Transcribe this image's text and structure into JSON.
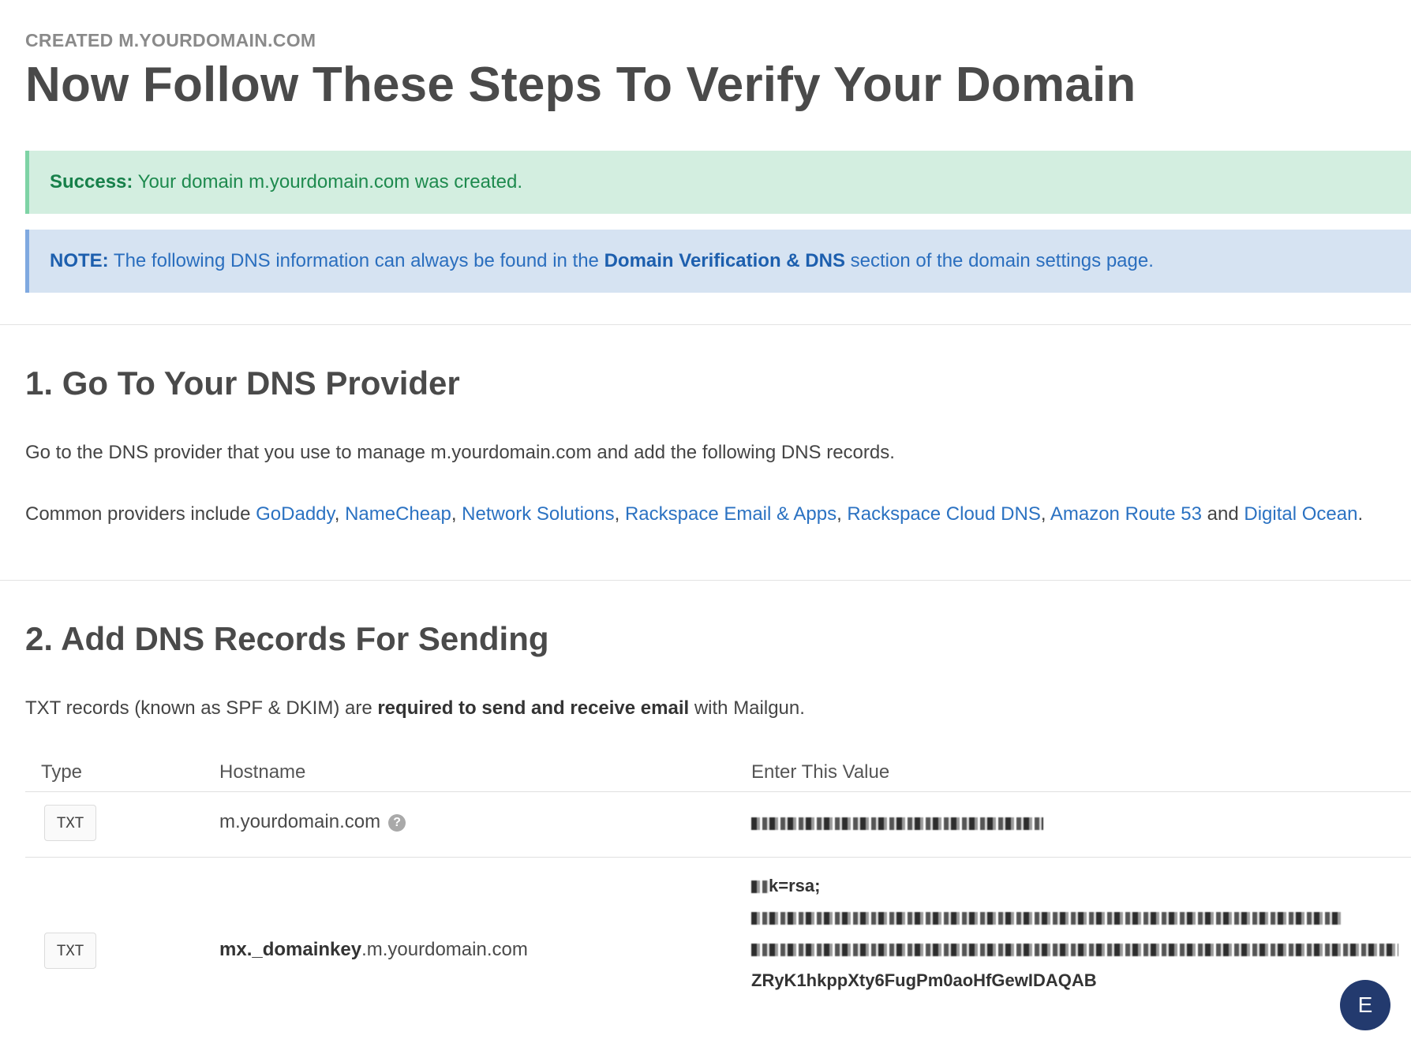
{
  "header": {
    "overline": "CREATED M.YOURDOMAIN.COM",
    "title": "Now Follow These Steps To Verify Your Domain"
  },
  "alerts": {
    "success_label": "Success:",
    "success_text": " Your domain m.yourdomain.com was created.",
    "note_label": "NOTE:",
    "note_text_1": " The following DNS information can always be found in the ",
    "note_link": "Domain Verification & DNS",
    "note_text_2": " section of the domain settings page."
  },
  "step1": {
    "title": "1. Go To Your DNS Provider",
    "intro": "Go to the DNS provider that you use to manage m.yourdomain.com and add the following DNS records.",
    "providers_prefix": "Common providers include ",
    "providers": [
      "GoDaddy",
      "NameCheap",
      "Network Solutions",
      "Rackspace Email & Apps",
      "Rackspace Cloud DNS",
      "Amazon Route 53"
    ],
    "providers_and": " and ",
    "providers_last": "Digital Ocean",
    "providers_suffix": "."
  },
  "step2": {
    "title": "2. Add DNS Records For Sending",
    "intro_1": "TXT records (known as SPF & DKIM) are ",
    "intro_bold": "required to send and receive email",
    "intro_2": " with Mailgun.",
    "columns": [
      "Type",
      "Hostname",
      "Enter This Value"
    ],
    "rows": [
      {
        "type": "TXT",
        "host_bold": "",
        "host": "m.yourdomain.com",
        "value_lines": [
          "(blurred)"
        ]
      },
      {
        "type": "TXT",
        "host_bold": "mx._domainkey",
        "host": ".m.yourdomain.com",
        "value_lines": [
          "k=rsa;",
          "(blurred)gnF9\\",
          "(blurred)",
          "ZRyK1hkppXty6FugPm0aoHfGewIDAQAB"
        ]
      }
    ]
  },
  "user": {
    "avatar_initial": "E"
  },
  "colors": {
    "success_bg": "#d3eee0",
    "success_text": "#1e8a4e",
    "note_bg": "#d6e3f2",
    "note_text": "#2a6ebe",
    "link": "#2b72c2",
    "avatar_bg": "#233a6e"
  }
}
